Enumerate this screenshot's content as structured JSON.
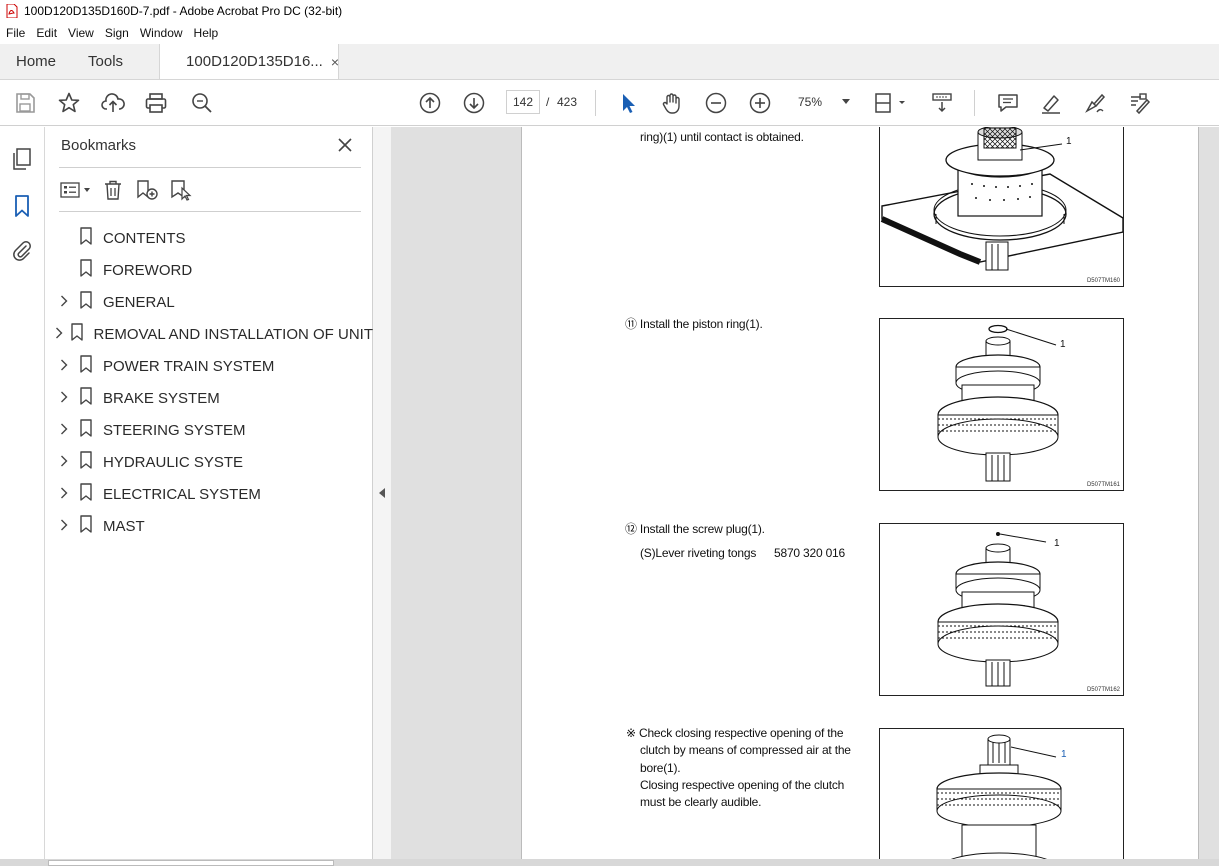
{
  "window": {
    "title": "100D120D135D160D-7.pdf - Adobe Acrobat Pro DC (32-bit)"
  },
  "menu": [
    "File",
    "Edit",
    "View",
    "Sign",
    "Window",
    "Help"
  ],
  "tabs": {
    "home": "Home",
    "tools": "Tools",
    "document": "100D120D135D16...",
    "close": "×"
  },
  "toolbar": {
    "page_current": "142",
    "page_separator": "/",
    "page_total": "423",
    "zoom": "75%"
  },
  "bookmarks": {
    "title": "Bookmarks",
    "items": [
      {
        "label": "CONTENTS",
        "expandable": false
      },
      {
        "label": "FOREWORD",
        "expandable": false
      },
      {
        "label": "GENERAL",
        "expandable": true
      },
      {
        "label": "REMOVAL AND INSTALLATION OF UNIT",
        "expandable": true
      },
      {
        "label": "POWER TRAIN SYSTEM",
        "expandable": true
      },
      {
        "label": "BRAKE SYSTEM",
        "expandable": true
      },
      {
        "label": "STEERING SYSTEM",
        "expandable": true
      },
      {
        "label": "HYDRAULIC SYSTE",
        "expandable": true
      },
      {
        "label": "ELECTRICAL SYSTEM",
        "expandable": true
      },
      {
        "label": "MAST",
        "expandable": true
      }
    ]
  },
  "document": {
    "steps": [
      {
        "text": "ring)(1) until contact is obtained."
      },
      {
        "text": "⑪ Install the piston ring(1)."
      },
      {
        "text": "⑫ Install the screw plug(1).",
        "sub": "(S)Lever riveting tongs",
        "sub_value": "5870 320 016"
      },
      {
        "lines": [
          "※ Check closing respective  opening of the",
          "clutch by means of compressed air at the",
          "bore(1).",
          "Closing respective  opening of the clutch",
          "must be clearly audible."
        ]
      }
    ],
    "figures": [
      {
        "code": "D507TM160",
        "callout": "1"
      },
      {
        "code": "D507TM161",
        "callout": "1"
      },
      {
        "code": "D507TM162",
        "callout": "1"
      },
      {
        "code": "",
        "callout": "1"
      }
    ]
  }
}
